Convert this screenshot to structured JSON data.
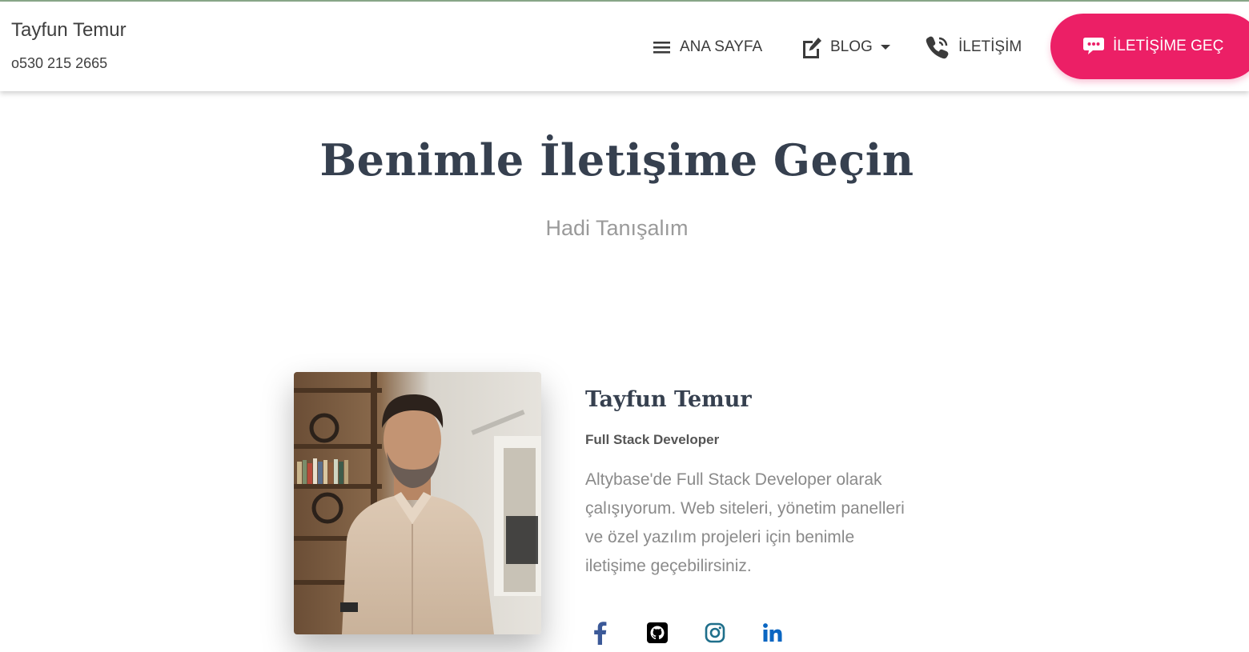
{
  "header": {
    "brand_name": "Tayfun Temur",
    "phone": "o530 215 2665",
    "nav": {
      "home": "ANA SAYFA",
      "blog": "BLOG",
      "contact": "İLETİŞİM"
    },
    "cta_label": "İLETİŞİME GEÇ",
    "cta_color": "#ec1f66"
  },
  "hero": {
    "title": "Benimle İletişime Geçin",
    "subtitle": "Hadi Tanışalım"
  },
  "profile": {
    "name": "Tayfun Temur",
    "role": "Full Stack Developer",
    "bio_lines": [
      "Altybase'de Full Stack Developer olarak",
      "çalışıyorum. Web siteleri, yönetim panelleri",
      "ve özel yazılım projeleri için benimle",
      "iletişime geçebilirsiniz."
    ],
    "socials": [
      {
        "icon": "facebook-icon",
        "color": "#3b5998"
      },
      {
        "icon": "github-icon",
        "color": "#000000"
      },
      {
        "icon": "instagram-icon",
        "color": "#1f6f8b"
      },
      {
        "icon": "linkedin-icon",
        "color": "#0a66c2"
      }
    ]
  }
}
